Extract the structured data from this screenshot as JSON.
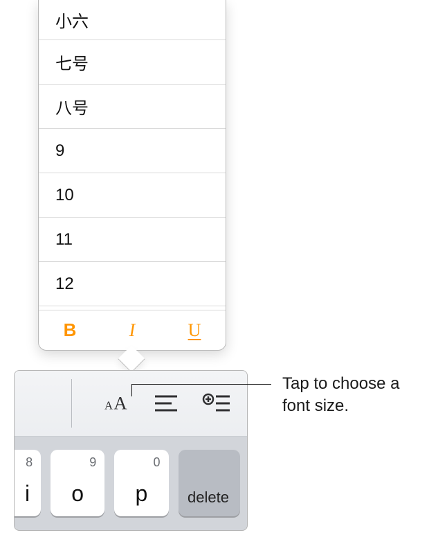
{
  "font_sizes": [
    "小六",
    "七号",
    "八号",
    "9",
    "10",
    "11",
    "12"
  ],
  "format": {
    "bold": "B",
    "italic": "I",
    "underline": "U"
  },
  "keys": [
    {
      "main": "i",
      "alt": "8"
    },
    {
      "main": "o",
      "alt": "9"
    },
    {
      "main": "p",
      "alt": "0"
    },
    {
      "main": "delete",
      "alt": ""
    }
  ],
  "callout": "Tap to choose a font size.",
  "icons": {
    "font_size": "font-size-icon",
    "align": "align-icon",
    "list_insert": "list-insert-icon"
  }
}
